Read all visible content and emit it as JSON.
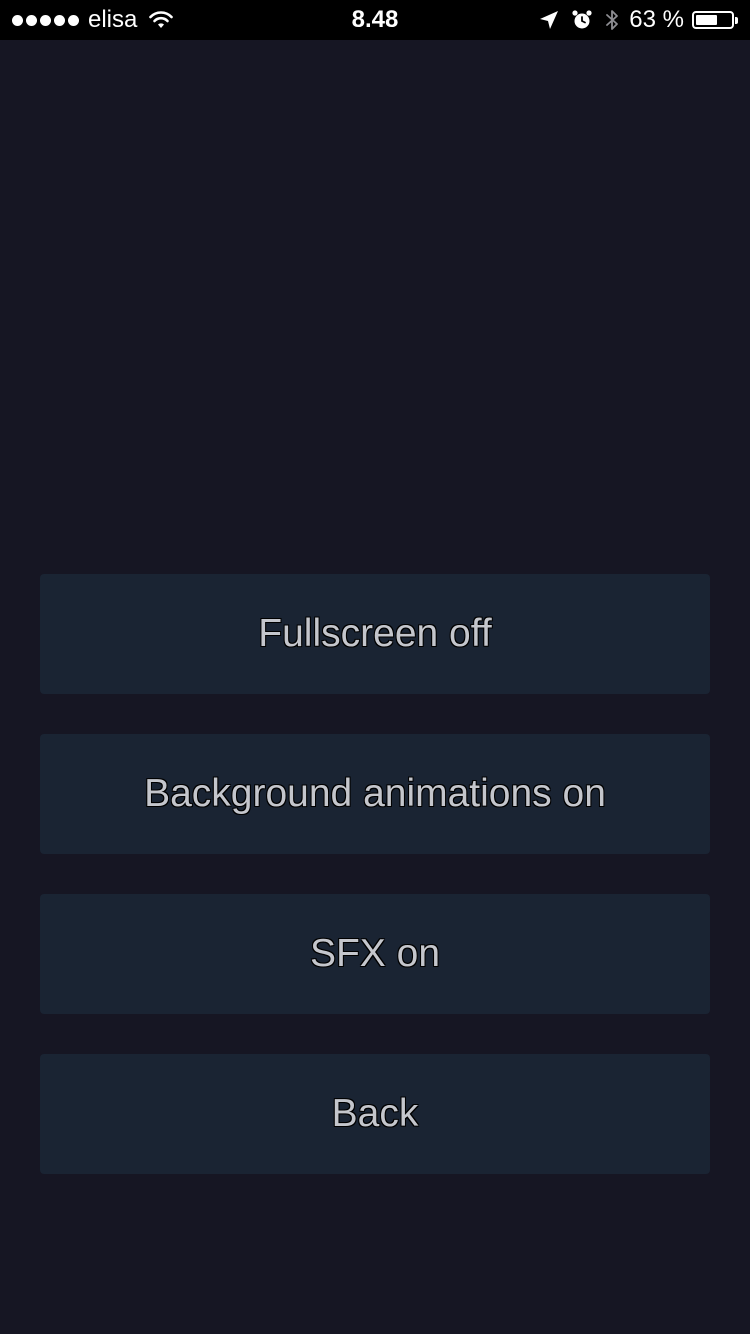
{
  "status_bar": {
    "signal_bars": 5,
    "carrier": "elisa",
    "time": "8.48",
    "battery_percent_text": "63 %",
    "battery_level": 0.63,
    "icons": [
      "wifi-icon",
      "location-arrow-icon",
      "alarm-clock-icon",
      "bluetooth-icon",
      "battery-icon"
    ]
  },
  "menu": {
    "buttons": [
      {
        "label": "Fullscreen off"
      },
      {
        "label": "Background animations on"
      },
      {
        "label": "SFX on"
      },
      {
        "label": "Back"
      }
    ]
  },
  "colors": {
    "background": "#161623",
    "button_background": "#1a2433",
    "button_text": "#c4c6cc",
    "status_bar_background": "#000000"
  }
}
